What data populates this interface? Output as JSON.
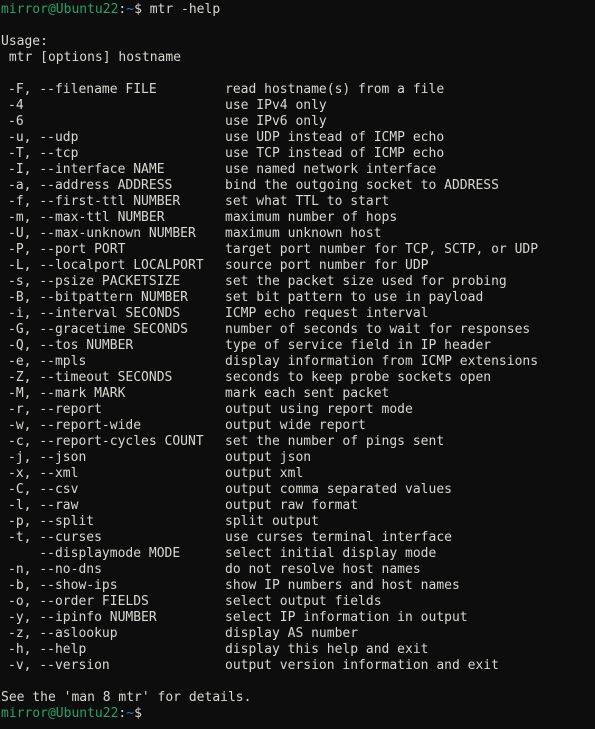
{
  "terminal": {
    "background_color": "#0d0d0d",
    "foreground_color": "#d8d8d2",
    "prompt_user_color": "#26a269",
    "prompt_path_color": "#2a7ae2",
    "prompt": {
      "user_host": "mirror@Ubuntu22",
      "separator": ":",
      "path": "~",
      "sigil": "$"
    },
    "command": " mtr -help",
    "usage_label": "Usage:",
    "usage_line": " mtr [options] hostname",
    "footer_line": "See the 'man 8 mtr' for details.",
    "options": [
      {
        "flag": "-F, --filename FILE",
        "desc": "read hostname(s) from a file"
      },
      {
        "flag": "-4",
        "desc": "use IPv4 only"
      },
      {
        "flag": "-6",
        "desc": "use IPv6 only"
      },
      {
        "flag": "-u, --udp",
        "desc": "use UDP instead of ICMP echo"
      },
      {
        "flag": "-T, --tcp",
        "desc": "use TCP instead of ICMP echo"
      },
      {
        "flag": "-I, --interface NAME",
        "desc": "use named network interface"
      },
      {
        "flag": "-a, --address ADDRESS",
        "desc": "bind the outgoing socket to ADDRESS"
      },
      {
        "flag": "-f, --first-ttl NUMBER",
        "desc": "set what TTL to start"
      },
      {
        "flag": "-m, --max-ttl NUMBER",
        "desc": "maximum number of hops"
      },
      {
        "flag": "-U, --max-unknown NUMBER",
        "desc": "maximum unknown host"
      },
      {
        "flag": "-P, --port PORT",
        "desc": "target port number for TCP, SCTP, or UDP"
      },
      {
        "flag": "-L, --localport LOCALPORT",
        "desc": "source port number for UDP"
      },
      {
        "flag": "-s, --psize PACKETSIZE",
        "desc": "set the packet size used for probing"
      },
      {
        "flag": "-B, --bitpattern NUMBER",
        "desc": "set bit pattern to use in payload"
      },
      {
        "flag": "-i, --interval SECONDS",
        "desc": "ICMP echo request interval"
      },
      {
        "flag": "-G, --gracetime SECONDS",
        "desc": "number of seconds to wait for responses"
      },
      {
        "flag": "-Q, --tos NUMBER",
        "desc": "type of service field in IP header"
      },
      {
        "flag": "-e, --mpls",
        "desc": "display information from ICMP extensions"
      },
      {
        "flag": "-Z, --timeout SECONDS",
        "desc": "seconds to keep probe sockets open"
      },
      {
        "flag": "-M, --mark MARK",
        "desc": "mark each sent packet"
      },
      {
        "flag": "-r, --report",
        "desc": "output using report mode"
      },
      {
        "flag": "-w, --report-wide",
        "desc": "output wide report"
      },
      {
        "flag": "-c, --report-cycles COUNT",
        "desc": "set the number of pings sent"
      },
      {
        "flag": "-j, --json",
        "desc": "output json"
      },
      {
        "flag": "-x, --xml",
        "desc": "output xml"
      },
      {
        "flag": "-C, --csv",
        "desc": "output comma separated values"
      },
      {
        "flag": "-l, --raw",
        "desc": "output raw format"
      },
      {
        "flag": "-p, --split",
        "desc": "split output"
      },
      {
        "flag": "-t, --curses",
        "desc": "use curses terminal interface"
      },
      {
        "flag": "    --displaymode MODE",
        "desc": "select initial display mode"
      },
      {
        "flag": "-n, --no-dns",
        "desc": "do not resolve host names"
      },
      {
        "flag": "-b, --show-ips",
        "desc": "show IP numbers and host names"
      },
      {
        "flag": "-o, --order FIELDS",
        "desc": "select output fields"
      },
      {
        "flag": "-y, --ipinfo NUMBER",
        "desc": "select IP information in output"
      },
      {
        "flag": "-z, --aslookup",
        "desc": "display AS number"
      },
      {
        "flag": "-h, --help",
        "desc": "display this help and exit"
      },
      {
        "flag": "-v, --version",
        "desc": "output version information and exit"
      }
    ]
  }
}
